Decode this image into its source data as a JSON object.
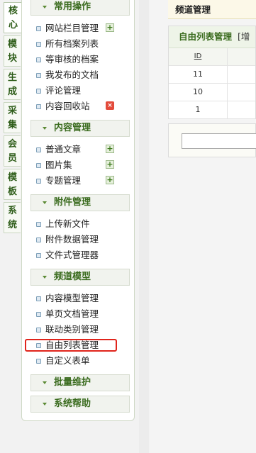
{
  "vtabs": [
    {
      "label": "核\n心",
      "active": true
    },
    {
      "label": "模\n块",
      "active": false
    },
    {
      "label": "生\n成",
      "active": false
    },
    {
      "label": "采\n集",
      "active": false
    },
    {
      "label": "会\n员",
      "active": false
    },
    {
      "label": "模\n板",
      "active": false
    },
    {
      "label": "系\n统",
      "active": false
    }
  ],
  "menu": {
    "sec_common": "常用操作",
    "common_items": [
      "网站栏目管理",
      "所有档案列表",
      "等审核的档案",
      "我发布的文档",
      "评论管理",
      "内容回收站"
    ],
    "sec_content": "内容管理",
    "content_items": [
      "普通文章",
      "图片集",
      "专题管理"
    ],
    "sec_attach": "附件管理",
    "attach_items": [
      "上传新文件",
      "附件数据管理",
      "文件式管理器"
    ],
    "sec_channel": "频道模型",
    "channel_items": [
      "内容模型管理",
      "单页文档管理",
      "联动类别管理",
      "自由列表管理",
      "自定义表单"
    ],
    "sec_batch": "批量维护",
    "sec_help": "系统帮助",
    "add_icon": "+",
    "del_icon": "×"
  },
  "right": {
    "topbar_title": "频道管理",
    "panel_title": "自由列表管理",
    "panel_extra": "[增",
    "table_header": "ID",
    "rows": [
      "11",
      "10",
      "1"
    ]
  }
}
